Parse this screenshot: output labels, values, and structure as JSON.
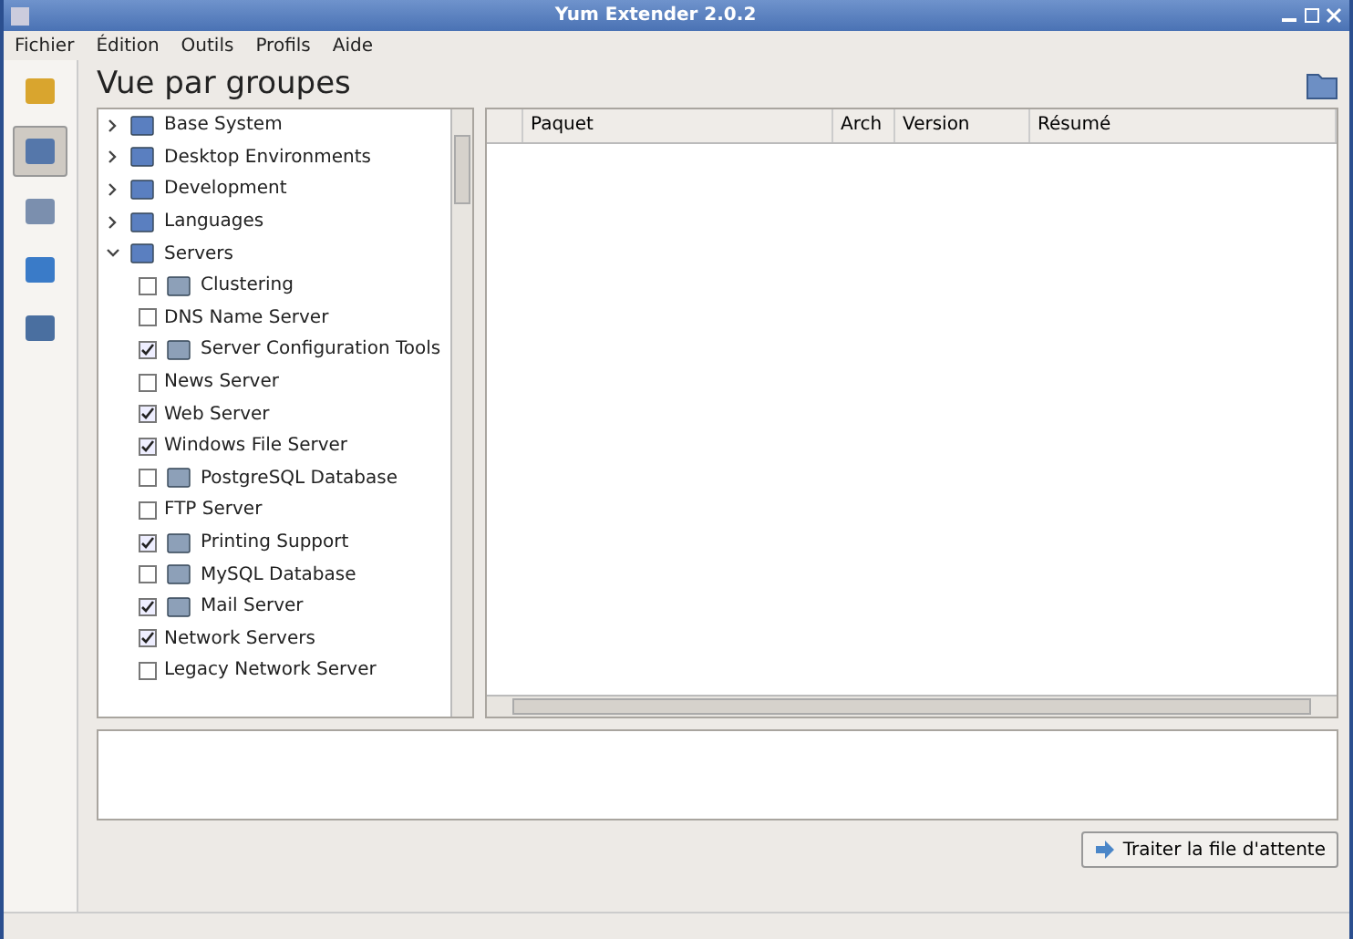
{
  "window": {
    "title": "Yum Extender 2.0.2"
  },
  "menu": [
    "Fichier",
    "Édition",
    "Outils",
    "Profils",
    "Aide"
  ],
  "header": {
    "title": "Vue par groupes"
  },
  "views": [
    {
      "kind": "packages",
      "selected": false
    },
    {
      "kind": "groups",
      "selected": true
    },
    {
      "kind": "queue",
      "selected": false
    },
    {
      "kind": "repos",
      "selected": false
    },
    {
      "kind": "output",
      "selected": false
    }
  ],
  "tree": [
    {
      "label": "Base System",
      "expanded": false
    },
    {
      "label": "Desktop Environments",
      "expanded": false
    },
    {
      "label": "Development",
      "expanded": false
    },
    {
      "label": "Languages",
      "expanded": false
    },
    {
      "label": "Servers",
      "expanded": true,
      "children": [
        {
          "label": "Clustering",
          "checked": false,
          "icon": true
        },
        {
          "label": "DNS Name Server",
          "checked": false,
          "icon": false
        },
        {
          "label": "Server Configuration Tools",
          "checked": true,
          "icon": true
        },
        {
          "label": "News Server",
          "checked": false,
          "icon": false
        },
        {
          "label": "Web Server",
          "checked": true,
          "icon": false
        },
        {
          "label": "Windows File Server",
          "checked": true,
          "icon": false
        },
        {
          "label": "PostgreSQL Database",
          "checked": false,
          "icon": true
        },
        {
          "label": "FTP Server",
          "checked": false,
          "icon": false
        },
        {
          "label": "Printing Support",
          "checked": true,
          "icon": true
        },
        {
          "label": "MySQL Database",
          "checked": false,
          "icon": true
        },
        {
          "label": "Mail Server",
          "checked": true,
          "icon": true
        },
        {
          "label": "Network Servers",
          "checked": true,
          "icon": false
        },
        {
          "label": "Legacy Network Server",
          "checked": false,
          "icon": false
        }
      ]
    }
  ],
  "table": {
    "columns": [
      "Paquet",
      "Arch",
      "Version",
      "Résumé"
    ]
  },
  "buttons": [
    "Traiter la file d'attente"
  ]
}
